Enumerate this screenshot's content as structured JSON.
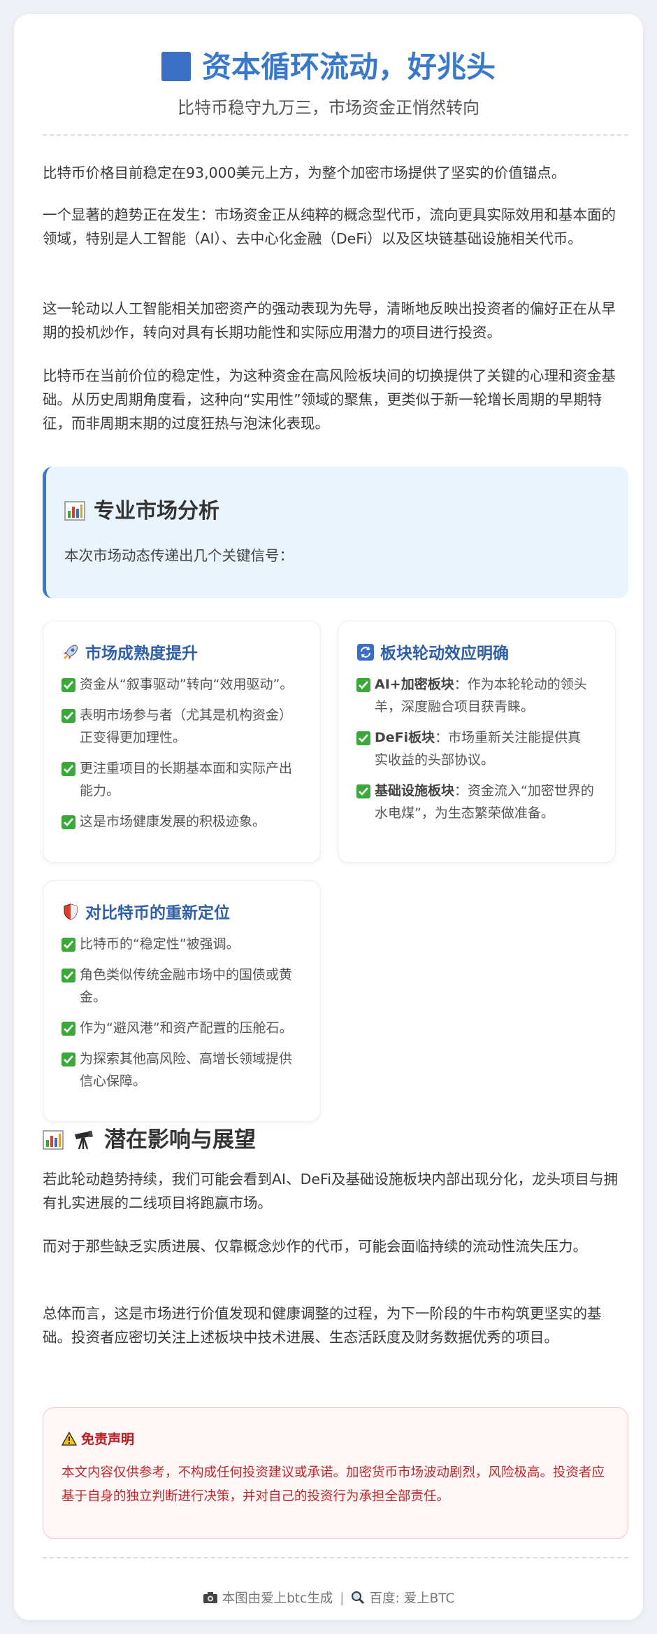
{
  "header": {
    "title": "资本循环流动，好兆头",
    "subtitle": "比特币稳守九万三，市场资金正悄然转向"
  },
  "intro": [
    "比特币价格目前稳定在93,000美元上方，为整个加密市场提供了坚实的价值锚点。",
    "一个显著的趋势正在发生：市场资金正从纯粹的概念型代币，流向更具实际效用和基本面的领域，特别是人工智能（AI）、去中心化金融（DeFi）以及区块链基础设施相关代币。",
    "这一轮动以人工智能相关加密资产的强动表现为先导，清晰地反映出投资者的偏好正在从早期的投机炒作，转向对具有长期功能性和实际应用潜力的项目进行投资。",
    "比特币在当前价位的稳定性，为这种资金在高风险板块间的切换提供了关键的心理和资金基础。从历史周期角度看，这种向“实用性”领域的聚焦，更类似于新一轮增长周期的早期特征，而非周期末期的过度狂热与泡沫化表现。"
  ],
  "analysis": {
    "title": "专业市场分析",
    "text": "本次市场动态传递出几个关键信号："
  },
  "cards": [
    {
      "icon": "rocket-icon",
      "title": "市场成熟度提升",
      "items": [
        {
          "bold": "",
          "text": "资金从“叙事驱动”转向“效用驱动”。"
        },
        {
          "bold": "",
          "text": "表明市场参与者（尤其是机构资金）正变得更加理性。"
        },
        {
          "bold": "",
          "text": "更注重项目的长期基本面和实际产出能力。"
        },
        {
          "bold": "",
          "text": "这是市场健康发展的积极迹象。"
        }
      ]
    },
    {
      "icon": "rotate-icon",
      "title": "板块轮动效应明确",
      "items": [
        {
          "bold": "AI+加密板块",
          "text": "：作为本轮轮动的领头羊，深度融合项目获青睐。"
        },
        {
          "bold": "DeFi板块",
          "text": "：市场重新关注能提供真实收益的头部协议。"
        },
        {
          "bold": "基础设施板块",
          "text": "：资金流入“加密世界的水电煤”，为生态繁荣做准备。"
        }
      ]
    },
    {
      "icon": "shield-icon",
      "title": "对比特币的重新定位",
      "items": [
        {
          "bold": "",
          "text": "比特币的“稳定性”被强调。"
        },
        {
          "bold": "",
          "text": "角色类似传统金融市场中的国债或黄金。"
        },
        {
          "bold": "",
          "text": "作为“避风港”和资产配置的压舱石。"
        },
        {
          "bold": "",
          "text": "为探索其他高风险、高增长领域提供信心保障。"
        }
      ]
    }
  ],
  "outlook": {
    "title": "潜在影响与展望",
    "paragraphs": [
      "若此轮动趋势持续，我们可能会看到AI、DeFi及基础设施板块内部出现分化，龙头项目与拥有扎实进展的二线项目将跑赢市场。",
      "而对于那些缺乏实质进展、仅靠概念炒作的代币，可能会面临持续的流动性流失压力。",
      "总体而言，这是市场进行价值发现和健康调整的过程，为下一阶段的牛市构筑更坚实的基础。投资者应密切关注上述板块中技术进展、生态活跃度及财务数据优秀的项目。"
    ]
  },
  "disclaimer": {
    "title": "免责声明",
    "text": "本文内容仅供参考，不构成任何投资建议或承诺。加密货币市场波动剧烈，风险极高。投资者应基于自身的独立判断进行决策，并对自己的投资行为承担全部责任。"
  },
  "footer": {
    "generated": "本图由爱上btc生成",
    "separator": "|",
    "search": "百度: 爱上BTC"
  },
  "colors": {
    "accent": "#3a78c9",
    "card_title": "#2f5fa7",
    "check": "#3aa93a",
    "warning": "#c0282d"
  }
}
